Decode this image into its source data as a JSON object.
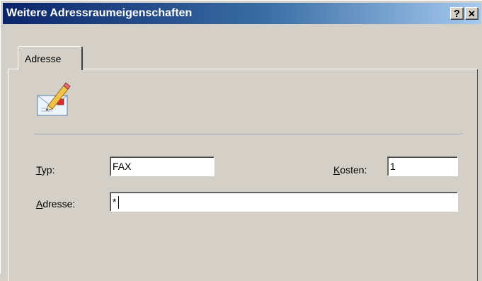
{
  "window": {
    "title": "Weitere Adressraumeigenschaften",
    "help_button": "?",
    "close_button": "✕"
  },
  "tabs": [
    {
      "label": "Adresse",
      "active": true
    }
  ],
  "icon": "envelope-pencil-icon",
  "form": {
    "type_label_accel": "T",
    "type_label_rest": "yp:",
    "type_value": "FAX",
    "cost_label_accel": "K",
    "cost_label_rest": "osten:",
    "cost_value": "1",
    "address_label_accel": "A",
    "address_label_rest": "dresse:",
    "address_value": "*"
  },
  "colors": {
    "titlebar_start": "#0a246a",
    "titlebar_end": "#a6caf0",
    "face": "#d4d0c8"
  }
}
